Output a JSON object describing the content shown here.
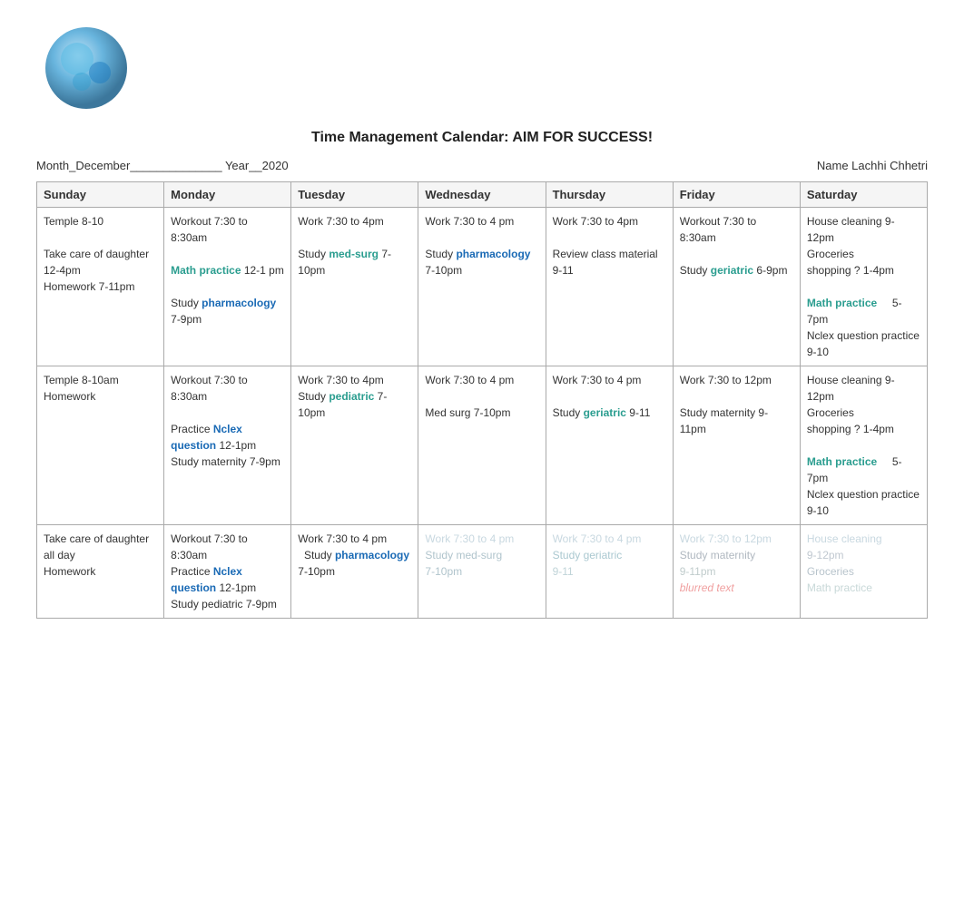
{
  "page": {
    "title": "Time Management Calendar: AIM FOR SUCCESS!",
    "month_label": "Month_December______________",
    "year_label": "Year__2020",
    "name_label": "Name Lachhi Chhetri"
  },
  "days": [
    "Sunday",
    "Monday",
    "Tuesday",
    "Wednesday",
    "Thursday",
    "Friday",
    "Saturday"
  ],
  "rows": [
    {
      "sunday": "Temple 8-10\n\nTake care of daughter 12-4pm\nHomework 7-11pm",
      "monday": "Workout 7:30 to 8:30am\n\nMath practice 12-1 pm\n\nStudy pharmacology 7-9pm",
      "tuesday": "Work 7:30 to 4pm\n\nStudy med-surg 7-10pm",
      "wednesday": "Work 7:30 to 4 pm\n\nStudy pharmacology 7-10pm",
      "thursday": "Work 7:30 to 4pm\n\nReview class material 9-11",
      "friday": "Workout 7:30 to 8:30am\n\nStudy geriatric 6-9pm",
      "saturday": "House cleaning 9-12pm\nGroceries shopping ? 1-4pm\n\nMath practice 5-7pm\nNclex question practice 9-10"
    },
    {
      "sunday": "Temple 8-10am\nHomework",
      "monday": "Workout 7:30 to 8:30am\n\nPractice Nclex question 12-1pm\nStudy maternity 7-9pm",
      "tuesday": "Work 7:30 to 4pm\nStudy pediatric 7-10pm",
      "wednesday": "Work 7:30 to 4 pm\n\nMed surg 7-10pm",
      "thursday": "Work 7:30 to 4 pm\n\nStudy geriatric 9-11",
      "friday": "Work 7:30 to 12pm\n\nStudy maternity 9-11pm",
      "saturday": "House cleaning 9-12pm\nGroceries shopping ? 1-4pm\n\nMath practice 5-7pm\nNclex question practice 9-10"
    },
    {
      "sunday": "Take care of daughter all day\nHomework",
      "monday": "Workout 7:30 to 8:30am\nPractice Nclex question 12-1pm\nStudy pediatric 7-9pm",
      "tuesday": "Work 7:30 to 4 pm\n  Study pharmacology 7-10pm",
      "wednesday": "",
      "thursday": "",
      "friday": "",
      "saturday": ""
    }
  ]
}
